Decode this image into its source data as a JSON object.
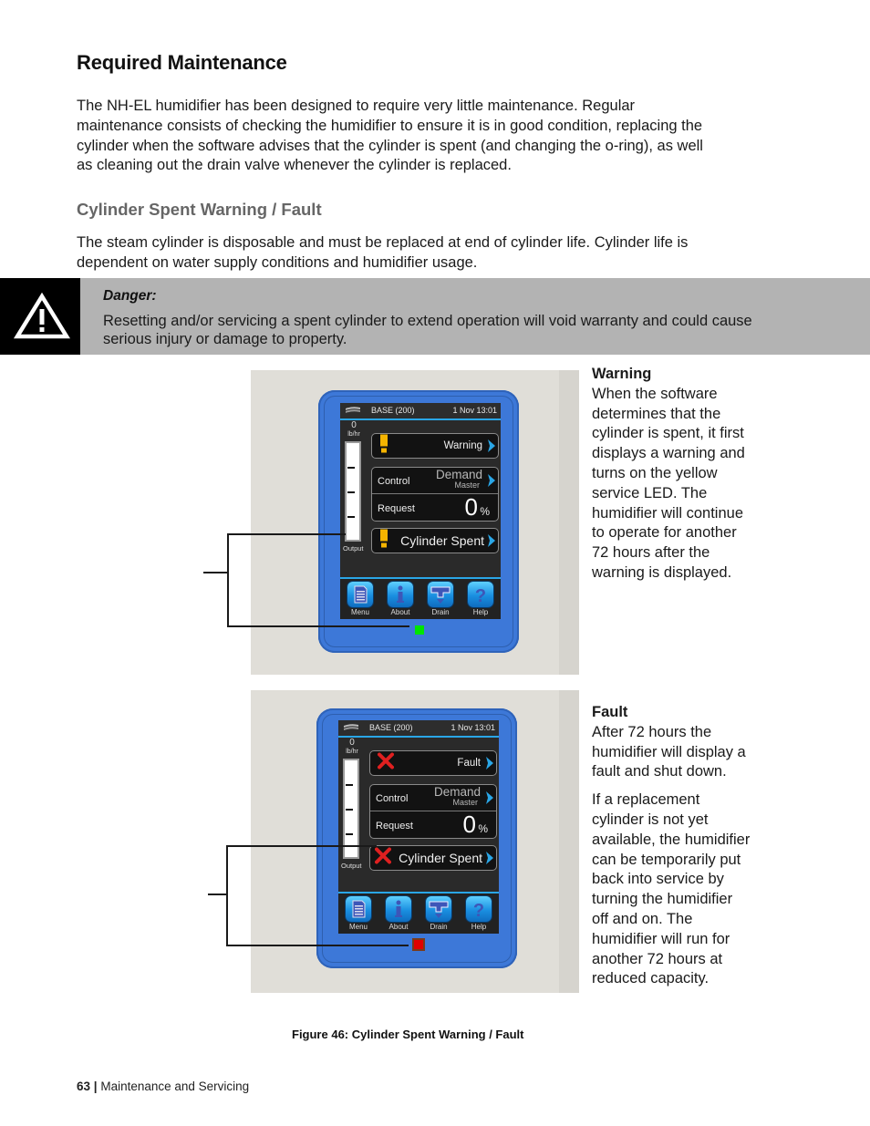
{
  "page": {
    "title": "Required Maintenance",
    "intro_lines": [
      "The NH-EL humidifier has been designed to require very little maintenance.  Regular",
      "maintenance consists of checking the humidifier to ensure it is in good condition, replacing the",
      "cylinder when the software advises that the cylinder is spent (and changing the o-ring), as well",
      "as cleaning out the drain valve whenever the cylinder is replaced."
    ],
    "subtitle": "Cylinder Spent Warning  / Fault",
    "sub_lines": [
      "The steam cylinder is disposable and must be replaced at end of cylinder life. Cylinder life is",
      "dependent on water supply conditions and humidifier usage."
    ]
  },
  "danger": {
    "icon": "warning-triangle-icon",
    "title": "Danger:",
    "lines": [
      "Resetting and/or servicing a spent cylinder to extend operation will void warranty and could cause",
      "serious injury or damage to property."
    ]
  },
  "figures": [
    {
      "device": {
        "header_base": "BASE (200)",
        "header_date": "1 Nov 13:01",
        "gauge_value": "0",
        "gauge_unit": "lb/hr",
        "gauge_label": "Output",
        "status_button": {
          "icon": "exclamation-icon",
          "label": "Warning"
        },
        "control_label": "Control",
        "control_value": "Demand",
        "control_sub": "Master",
        "request_label": "Request",
        "request_value": "0",
        "request_unit": "%",
        "alarm_button": {
          "icon": "exclamation-icon",
          "label": "Cylinder Spent"
        },
        "toolbar": [
          "Menu",
          "About",
          "Drain",
          "Help"
        ],
        "led_color": "#00e600"
      },
      "side_title": "Warning",
      "side_paragraphs": [
        [
          "When the software",
          "determines that the",
          "cylinder is spent, it first",
          "displays a warning and",
          "turns on the yellow",
          "service LED.  The",
          "humidifier will continue",
          "to operate for another",
          "72 hours after the",
          "warning is displayed."
        ]
      ]
    },
    {
      "device": {
        "header_base": "BASE (200)",
        "header_date": "1 Nov 13:01",
        "gauge_value": "0",
        "gauge_unit": "lb/hr",
        "gauge_label": "Output",
        "status_button": {
          "icon": "red-x-icon",
          "label": "Fault"
        },
        "control_label": "Control",
        "control_value": "Demand",
        "control_sub": "Master",
        "request_label": "Request",
        "request_value": "0",
        "request_unit": "%",
        "alarm_button": {
          "icon": "red-x-icon",
          "label": "Cylinder Spent"
        },
        "toolbar": [
          "Menu",
          "About",
          "Drain",
          "Help"
        ],
        "led_color": "#e00000"
      },
      "side_title": "Fault",
      "side_paragraphs": [
        [
          "After 72 hours the",
          "humidifier will display a",
          "fault and shut down."
        ],
        [
          "If a replacement",
          "cylinder is not yet",
          "available, the humidifier",
          "can be temporarily put",
          "back into service by",
          "turning the humidifier",
          "off and on.  The",
          "humidifier will run for",
          "another 72 hours at",
          "reduced capacity."
        ]
      ]
    }
  ],
  "caption": "Figure 46: Cylinder Spent Warning / Fault",
  "footer": {
    "page_number": "63",
    "separator": "|",
    "section": "Maintenance and Servicing"
  },
  "colors": {
    "device_blue": "#3d78d8",
    "screen_accent": "#2aa6e6",
    "warning_yellow": "#f5b400",
    "fault_red": "#e02020",
    "danger_band": "#b3b3b3"
  }
}
